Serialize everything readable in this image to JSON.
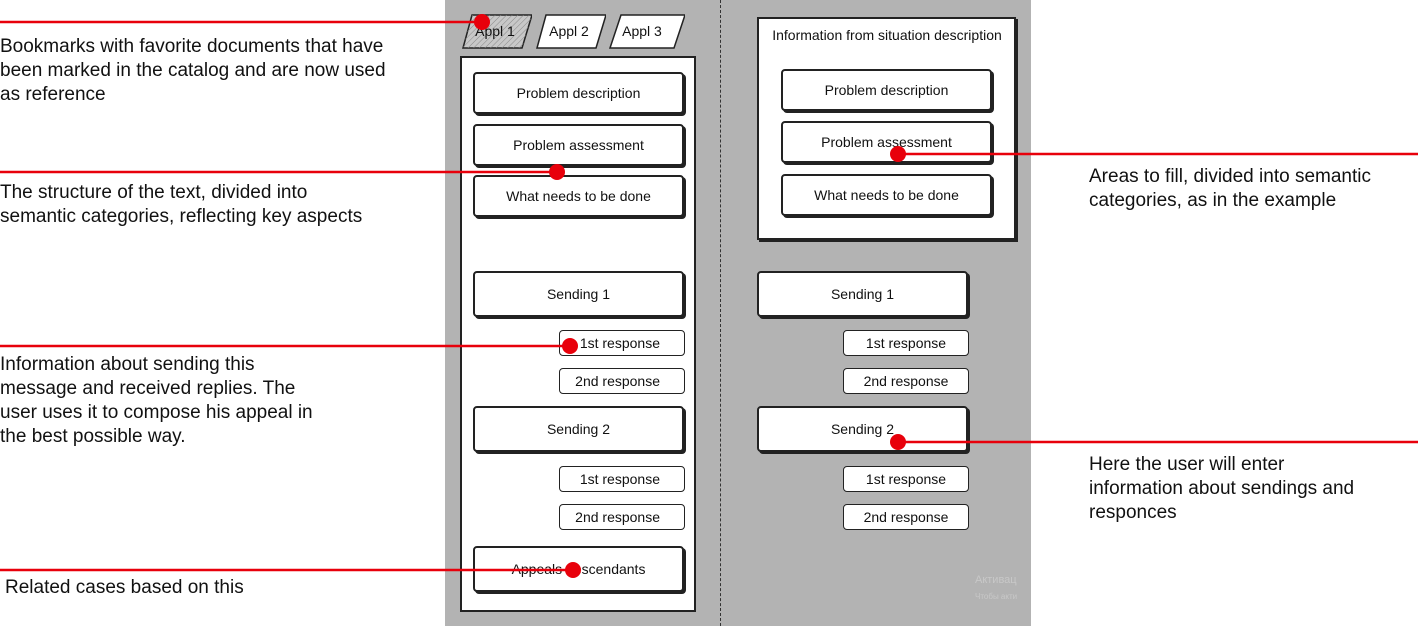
{
  "tabs": [
    "Appl 1",
    "Appl 2",
    "Appl 3"
  ],
  "left_panel": {
    "sections": [
      "Problem description",
      "Problem assessment",
      "What needs to be done"
    ],
    "sending1": "Sending 1",
    "sending1_responses": [
      "1st response",
      "2nd response"
    ],
    "sending2": "Sending 2",
    "sending2_responses": [
      "1st response",
      "2nd response"
    ],
    "appeals": "Appeals descendants"
  },
  "right_panel": {
    "title": "Information from situation description",
    "sections": [
      "Problem description",
      "Problem assessment",
      "What needs to be done"
    ],
    "sending1": "Sending 1",
    "sending1_responses": [
      "1st response",
      "2nd response"
    ],
    "sending2": "Sending 2",
    "sending2_responses": [
      "1st response",
      "2nd response"
    ]
  },
  "annotations": {
    "bookmarks": "Bookmarks with favorite documents that have been marked in the catalog and are now used as reference",
    "structure": "The structure of the text, divided into semantic categories, reflecting key aspects",
    "sending_info": "Information about sending this message and received replies. The user uses it to compose his appeal in the best possible way.",
    "related": "Related cases based on this",
    "areas": "Areas to fill, divided into semantic categories, as in the example",
    "user_enter": "Here the user will enter information about sendings and responces"
  },
  "watermark": [
    "Активац",
    "Чтобы акти"
  ],
  "colors": {
    "annotation_line": "#e8000b",
    "panel_bg": "#b3b3b3"
  }
}
